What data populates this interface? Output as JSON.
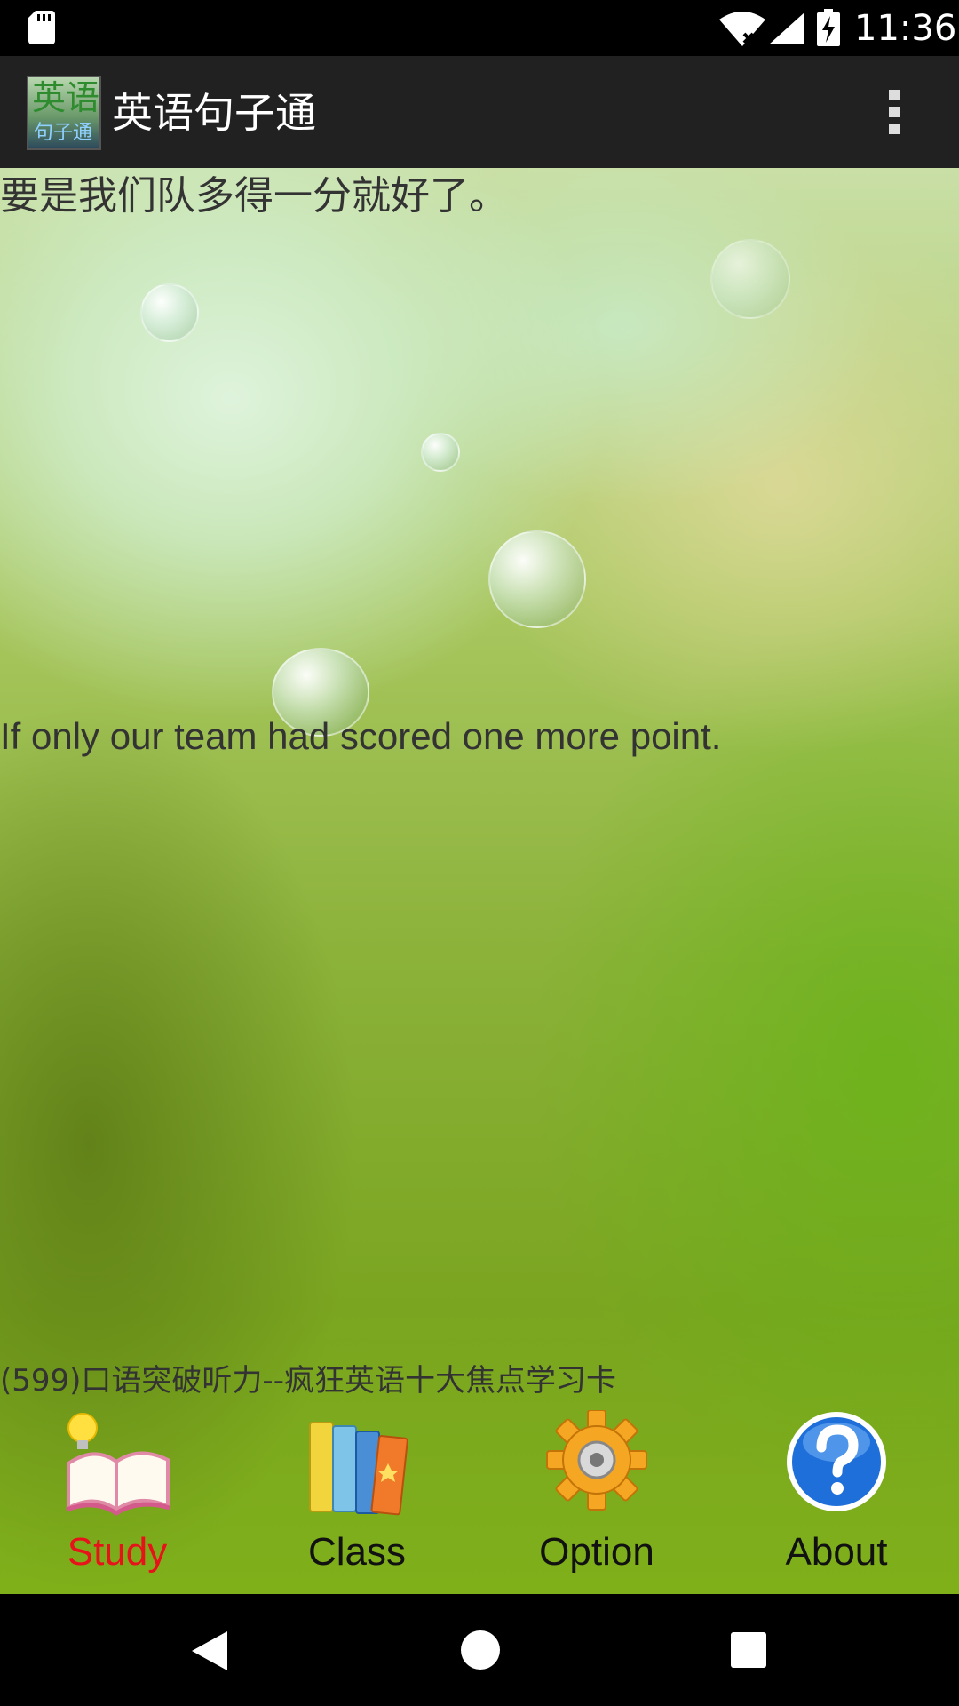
{
  "status_bar": {
    "time": "11:36",
    "icons": [
      "sd-card-icon",
      "wifi-icon",
      "signal-icon",
      "battery-charging-icon"
    ]
  },
  "app_bar": {
    "logo_line1": "英语",
    "logo_line2": "句子通",
    "title": "英语句子通",
    "menu_icon": "overflow-menu-icon"
  },
  "content": {
    "chinese_sentence": "要是我们队多得一分就好了。",
    "english_sentence": "If only our team had scored one more point.",
    "lesson": "(599)口语突破听力--疯狂英语十大焦点学习卡"
  },
  "tabs": [
    {
      "label": "Study",
      "icon": "open-book-lightbulb-icon",
      "active": true
    },
    {
      "label": "Class",
      "icon": "books-icon",
      "active": false
    },
    {
      "label": "Option",
      "icon": "gear-icon",
      "active": false
    },
    {
      "label": "About",
      "icon": "help-icon",
      "active": false
    }
  ],
  "colors": {
    "active_tab": "#e8121a",
    "app_bar": "#212121"
  },
  "nav_bar": {
    "icons": [
      "back-icon",
      "home-icon",
      "recents-icon"
    ]
  }
}
